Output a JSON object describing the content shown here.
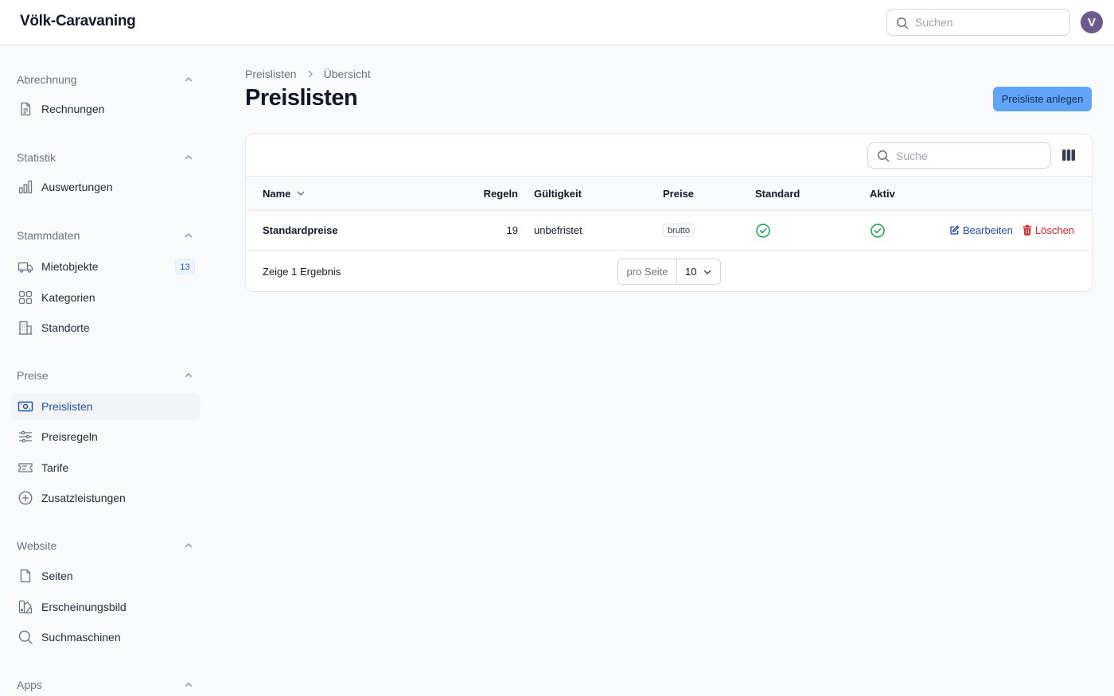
{
  "topbar": {
    "brand": "Völk-Caravaning",
    "search_placeholder": "Suchen",
    "avatar_initial": "V"
  },
  "sidebar": {
    "groups": [
      {
        "label": "Abrechnung",
        "items": [
          {
            "label": "Rechnungen",
            "icon": "document-icon"
          }
        ]
      },
      {
        "label": "Statistik",
        "items": [
          {
            "label": "Auswertungen",
            "icon": "bar-chart-icon"
          }
        ]
      },
      {
        "label": "Stammdaten",
        "items": [
          {
            "label": "Mietobjekte",
            "icon": "truck-icon",
            "badge": "13"
          },
          {
            "label": "Kategorien",
            "icon": "grid-icon"
          },
          {
            "label": "Standorte",
            "icon": "building-icon"
          }
        ]
      },
      {
        "label": "Preise",
        "items": [
          {
            "label": "Preislisten",
            "icon": "banknote-icon",
            "active": true
          },
          {
            "label": "Preisregeln",
            "icon": "sliders-icon"
          },
          {
            "label": "Tarife",
            "icon": "ticket-icon"
          },
          {
            "label": "Zusatzleistungen",
            "icon": "plus-circle-icon"
          }
        ]
      },
      {
        "label": "Website",
        "items": [
          {
            "label": "Seiten",
            "icon": "page-icon"
          },
          {
            "label": "Erscheinungsbild",
            "icon": "swatch-icon"
          },
          {
            "label": "Suchmaschinen",
            "icon": "magnifier-icon"
          }
        ]
      },
      {
        "label": "Apps",
        "items": []
      }
    ]
  },
  "breadcrumb": {
    "parent": "Preislisten",
    "current": "Übersicht"
  },
  "page": {
    "title": "Preislisten",
    "create_button": "Preisliste anlegen"
  },
  "table": {
    "search_placeholder": "Suche",
    "columns": {
      "name": "Name",
      "rules": "Regeln",
      "validity": "Gültigkeit",
      "prices": "Preise",
      "default": "Standard",
      "active": "Aktiv"
    },
    "rows": [
      {
        "name": "Standardpreise",
        "rules": "19",
        "validity": "unbefristet",
        "prices": "brutto",
        "default": true,
        "active": true,
        "edit": "Bearbeiten",
        "delete": "Löschen"
      }
    ],
    "footer": {
      "results": "Zeige 1 Ergebnis",
      "per_page_label": "pro Seite",
      "per_page_value": "10"
    }
  },
  "colors": {
    "accent": "#1e4fa6",
    "primary_button": "#60a5fa",
    "success": "#16a34a",
    "danger": "#dc2626",
    "avatar": "#6d5a8d"
  }
}
